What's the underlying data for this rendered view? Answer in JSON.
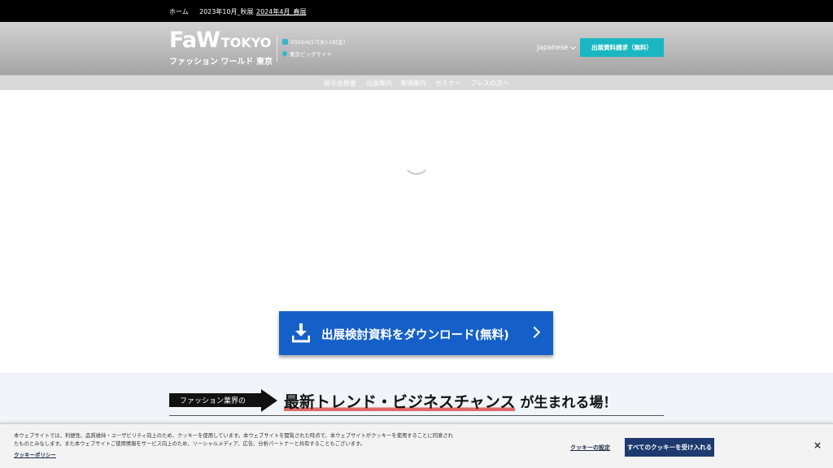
{
  "topbar": {
    "links": [
      {
        "label": "ホーム",
        "current": false
      },
      {
        "label": "2023年10月_秋展",
        "current": false
      },
      {
        "label": "2024年4月_春展",
        "current": true
      }
    ]
  },
  "header": {
    "logo_main": "FaW",
    "logo_tokyo": "TOKYO",
    "logo_sub": "ファッション ワールド 東京",
    "date": "2024/4/17[水]-19[金]",
    "venue": "東京ビッグサイト",
    "language": "Japanese",
    "request_button": "出展資料請求（無料）"
  },
  "nav": {
    "items": [
      "展示会概要",
      "出展案内",
      "来場案内",
      "セミナー",
      "プレスの方へ"
    ]
  },
  "download": {
    "label": "出展検討資料をダウンロード(無料)"
  },
  "trend": {
    "tag": "ファッション業界の",
    "highlight": "最新トレンド・ビジネスチャンス",
    "rest": "が生まれる場！"
  },
  "cookie": {
    "text": "本ウェブサイトでは、利便性、品質維持・ユーザビリティ向上のため、クッキーを使用しています。本ウェブサイトを閲覧された時点で、本ウェブサイトがクッキーを使用することに同意されたものとみなします。また本ウェブサイトご使用情報をサービス向上のため、ソーシャルメディア、広告、分析パートナーと共有することもございます。",
    "policy_link": "クッキーポリシー",
    "settings_link": "クッキーの設定",
    "accept_button": "すべてのクッキーを受け入れる",
    "close": "×"
  },
  "colors": {
    "accent": "#1ab7c2",
    "download_blue": "#1560c8",
    "cookie_button": "#1e3a6e",
    "highlight_underline": "#e06a6a"
  }
}
